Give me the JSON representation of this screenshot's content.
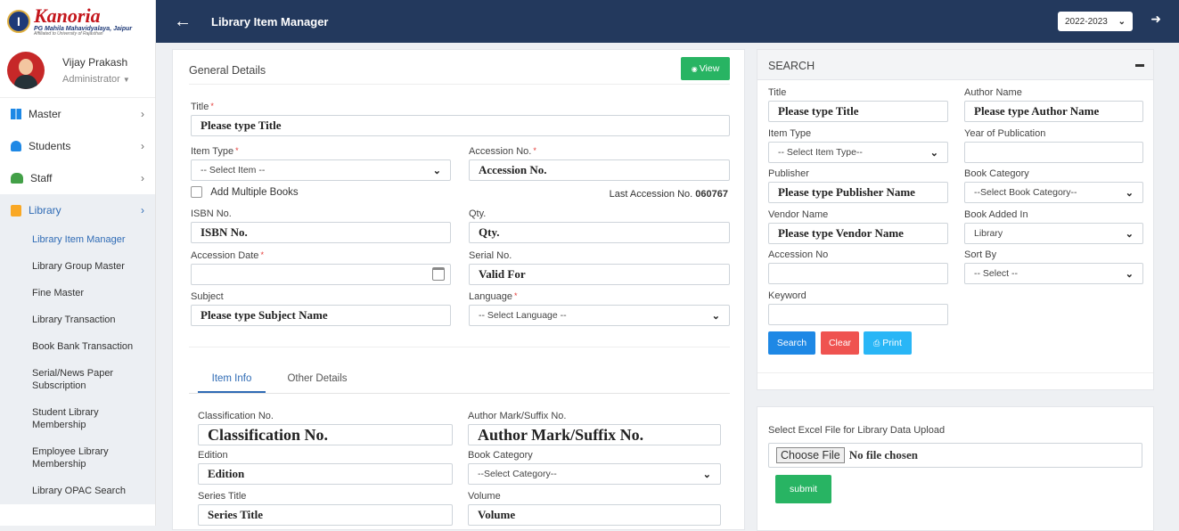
{
  "sidebar": {
    "logo_title": "Kanoria",
    "logo_subtitle": "PG Mahila Mahavidyalaya, Jaipur",
    "logo_affiliation": "Affiliated to University of Rajasthan",
    "user_name": "Vijay Prakash",
    "user_role": "Administrator",
    "menu": [
      {
        "label": "Master"
      },
      {
        "label": "Students"
      },
      {
        "label": "Staff"
      },
      {
        "label": "Library"
      }
    ],
    "library_submenu": [
      "Library Item Manager",
      "Library Group Master",
      "Fine Master",
      "Library Transaction",
      "Book Bank Transaction",
      "Serial/News Paper Subscription",
      "Student Library Membership",
      "Employee Library Membership",
      "Library OPAC Search"
    ]
  },
  "topbar": {
    "title": "Library Item Manager",
    "year": "2022-2023"
  },
  "general": {
    "heading": "General Details",
    "view_button": "View",
    "title_label": "Title",
    "title_value": "Please type Title",
    "item_type_label": "Item Type",
    "item_type_value": "-- Select Item --",
    "accession_no_label": "Accession No.",
    "accession_no_value": "Accession No.",
    "add_multiple_label": "Add Multiple Books",
    "last_accession_label": "Last Accession No.",
    "last_accession_value": "060767",
    "isbn_label": "ISBN No.",
    "isbn_value": "ISBN No.",
    "qty_label": "Qty.",
    "qty_value": "Qty.",
    "accession_date_label": "Accession Date",
    "serial_no_label": "Serial No.",
    "serial_no_value": "Valid For",
    "subject_label": "Subject",
    "subject_value": "Please type Subject Name",
    "language_label": "Language",
    "language_value": "-- Select Language --",
    "tabs": [
      "Item Info",
      "Other Details"
    ],
    "classification_label": "Classification No.",
    "classification_value": "Classification No.",
    "author_mark_label": "Author Mark/Suffix No.",
    "author_mark_value": "Author Mark/Suffix No.",
    "edition_label": "Edition",
    "edition_value": "Edition",
    "book_category_label": "Book Category",
    "book_category_value": "--Select Category--",
    "series_title_label": "Series Title",
    "series_title_value": "Series Title",
    "volume_label": "Volume",
    "volume_value": "Volume"
  },
  "search": {
    "heading": "SEARCH",
    "title_label": "Title",
    "title_value": "Please type Title",
    "author_label": "Author Name",
    "author_value": "Please type Author Name",
    "item_type_label": "Item Type",
    "item_type_value": "-- Select Item Type--",
    "year_label": "Year of Publication",
    "publisher_label": "Publisher",
    "publisher_value": "Please type Publisher Name",
    "book_category_label": "Book Category",
    "book_category_value": "--Select Book Category--",
    "vendor_label": "Vendor Name",
    "vendor_value": "Please type Vendor Name",
    "book_added_label": "Book Added In",
    "book_added_value": "Library",
    "accession_label": "Accession No",
    "sort_label": "Sort By",
    "sort_value": "-- Select --",
    "keyword_label": "Keyword",
    "search_button": "Search",
    "clear_button": "Clear",
    "print_button": "Print"
  },
  "upload": {
    "label": "Select Excel File for Library Data Upload",
    "choose_button": "Choose File",
    "no_file": "No file chosen",
    "submit_button": "submit"
  },
  "colors": {
    "topbar": "#23395d",
    "green": "#28b463",
    "blue": "#1e88e5",
    "red": "#ef5350",
    "cyan": "#29b6f6",
    "active_link": "#2f6bb5"
  }
}
